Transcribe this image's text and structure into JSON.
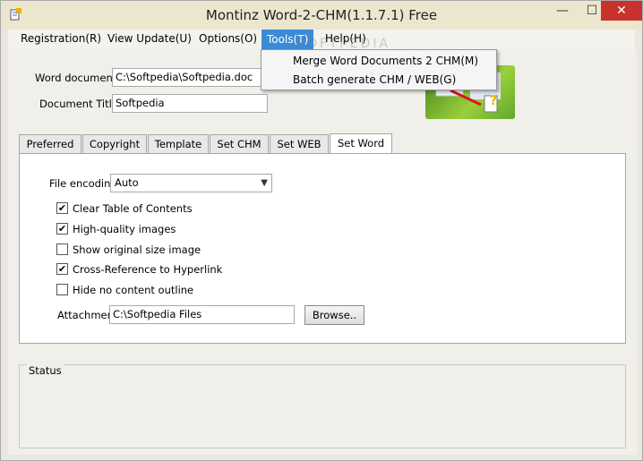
{
  "window": {
    "title": "Montinz Word-2-CHM(1.1.7.1) Free",
    "min": "—",
    "max": "☐",
    "close": "✕"
  },
  "menubar": {
    "items": [
      "Registration(R)",
      "View Update(U)",
      "Options(O)",
      "Tools(T)",
      "Help(H)"
    ]
  },
  "tools_menu": {
    "items": [
      "Merge Word Documents 2 CHM(M)",
      "Batch generate CHM / WEB(G)"
    ]
  },
  "form": {
    "word_document_label": "Word document:",
    "word_document_value": "C:\\Softpedia\\Softpedia.doc",
    "document_title_label": "Document Title:",
    "document_title_value": "Softpedia"
  },
  "tabs": [
    "Preferred",
    "Copyright",
    "Template",
    "Set CHM",
    "Set WEB",
    "Set Word"
  ],
  "set_word": {
    "file_encoding_label": "File encoding:",
    "file_encoding_value": "Auto",
    "options": [
      {
        "label": "Clear Table of Contents",
        "checked": true
      },
      {
        "label": "High-quality images",
        "checked": true
      },
      {
        "label": "Show original size image",
        "checked": false
      },
      {
        "label": "Cross-Reference to Hyperlink",
        "checked": true
      },
      {
        "label": "Hide no content outline",
        "checked": false
      }
    ],
    "attachment_label": "Attachment:",
    "attachment_value": "C:\\Softpedia Files",
    "browse_label": "Browse.."
  },
  "status": {
    "label": "Status"
  },
  "watermark": "SOFTPEDIA"
}
